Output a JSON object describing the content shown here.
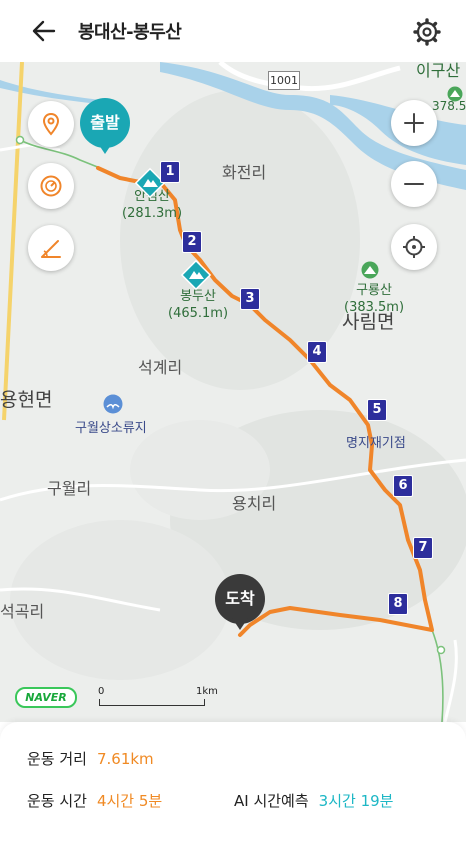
{
  "header": {
    "title": "봉대산-봉두산"
  },
  "map": {
    "places": {
      "hwajeonri": "화전리",
      "seokgyeri": "석계리",
      "yonghyeonmyeon": "용현면",
      "guwolri": "구월리",
      "yongchiri": "용치리",
      "sarimmyeon": "사림면",
      "seokgokri": "석곡리",
      "igusan": "이구산",
      "igusan_height": "378.5"
    },
    "road_number": "1001",
    "peaks": [
      {
        "name": "안점산",
        "height": "(281.3m)"
      },
      {
        "name": "봉두산",
        "height": "(465.1m)"
      },
      {
        "name": "구룡산",
        "height": "(383.5m)"
      }
    ],
    "pois": {
      "guwol_resort": "구월상소류지",
      "myeongji_point": "명지재기점"
    },
    "start_label": "출발",
    "end_label": "도착",
    "waypoints": [
      "1",
      "2",
      "3",
      "4",
      "5",
      "6",
      "7",
      "8"
    ],
    "logo": "NAVER",
    "scale": {
      "start": "0",
      "end": "1km"
    },
    "colors": {
      "route": "#f0852a",
      "start_pin": "#1aa7b4",
      "end_pin": "#333333",
      "waypoint": "#2d2e9c"
    }
  },
  "controls": {
    "location": "location-pin-icon",
    "speed": "speedometer-icon",
    "slope": "slope-icon",
    "zoom_in": "plus-icon",
    "zoom_out": "minus-icon",
    "locate": "crosshair-icon"
  },
  "stats": {
    "distance_label": "운동 거리",
    "distance_value": "7.61km",
    "time_label": "운동 시간",
    "time_value": "4시간 5분",
    "ai_label": "AI 시간예측",
    "ai_value": "3시간 19분"
  }
}
